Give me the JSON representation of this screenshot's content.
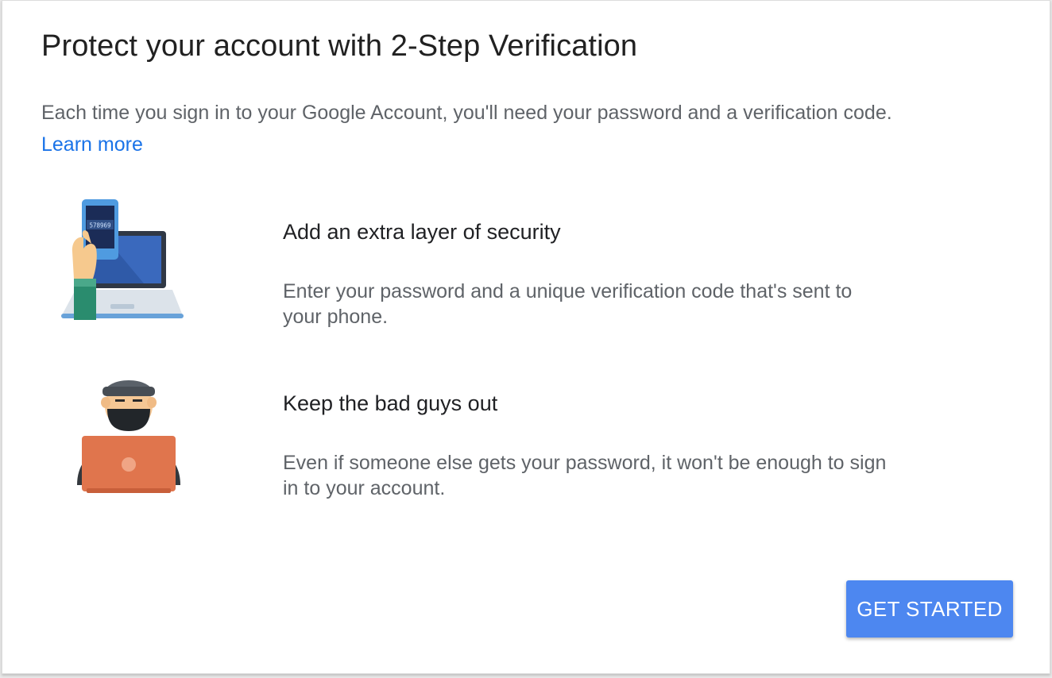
{
  "header": {
    "title": "Protect your account with 2-Step Verification"
  },
  "intro": {
    "text": "Each time you sign in to your Google Account, you'll need your password and a verification code.",
    "learn_more": "Learn more"
  },
  "features": [
    {
      "title": "Add an extra layer of security",
      "description": "Enter your password and a unique verification code that's sent to your phone.",
      "illustration": "phone-laptop-illustration",
      "phone_code": "578969"
    },
    {
      "title": "Keep the bad guys out",
      "description": "Even if someone else gets your password, it won't be enough to sign in to your account.",
      "illustration": "hacker-illustration"
    }
  ],
  "actions": {
    "get_started": "GET STARTED"
  },
  "colors": {
    "primary_button": "#4d87f0",
    "link": "#1a73e8",
    "title_text": "#212121",
    "body_text": "#5f6368"
  }
}
